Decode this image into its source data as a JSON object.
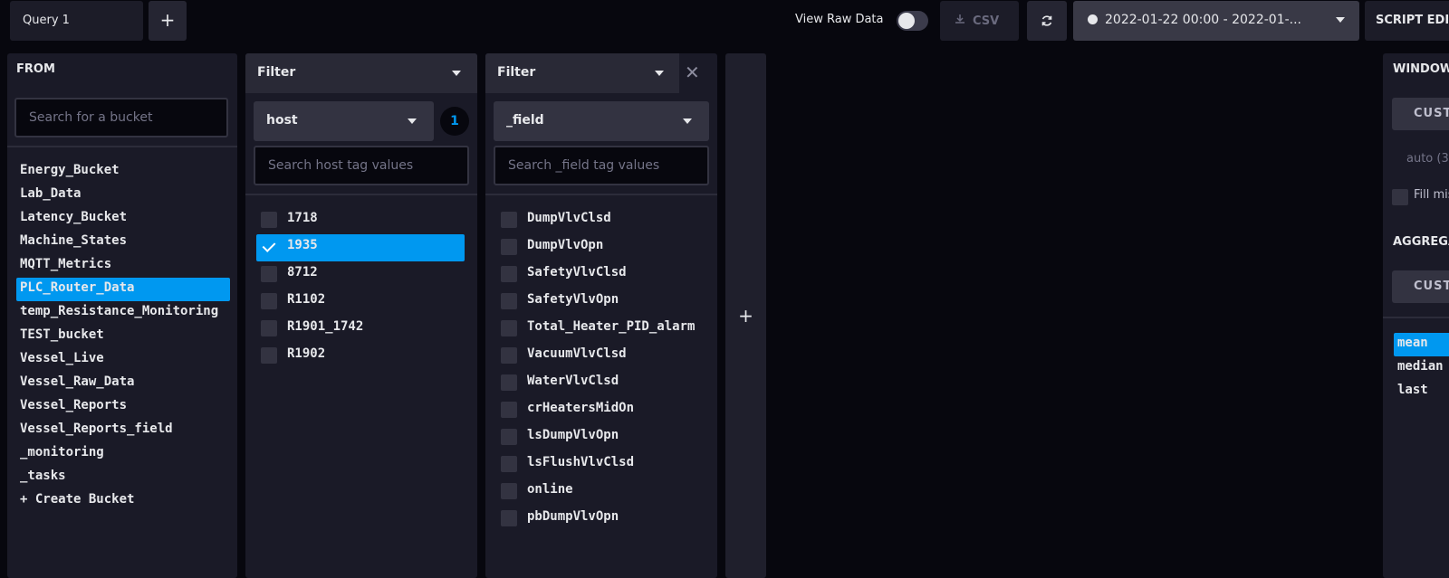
{
  "topbar": {
    "query_tab": "Query 1",
    "add_query": "+",
    "view_raw_label": "View Raw Data",
    "csv_label": "CSV",
    "time_range": "2022-01-22 00:00 - 2022-01-...",
    "script_editor": "SCRIPT EDITOR"
  },
  "from": {
    "title": "FROM",
    "search_placeholder": "Search for a bucket",
    "buckets": [
      "Energy_Bucket",
      "Lab_Data",
      "Latency_Bucket",
      "Machine_States",
      "MQTT_Metrics",
      "PLC_Router_Data",
      "temp_Resistance_Monitoring",
      "TEST_bucket",
      "Vessel_Live",
      "Vessel_Raw_Data",
      "Vessel_Reports",
      "Vessel_Reports_field",
      "_monitoring",
      "_tasks",
      "+ Create Bucket"
    ],
    "selected": "PLC_Router_Data"
  },
  "filter1": {
    "title": "Filter",
    "key": "host",
    "count": "1",
    "search_placeholder": "Search host tag values",
    "values": [
      "1718",
      "1935",
      "8712",
      "R1102",
      "R1901_1742",
      "R1902"
    ],
    "selected": "1935"
  },
  "filter2": {
    "title": "Filter",
    "key": "_field",
    "search_placeholder": "Search _field tag values",
    "values": [
      "DumpVlvClsd",
      "DumpVlvOpn",
      "SafetyVlvClsd",
      "SafetyVlvOpn",
      "Total_Heater_PID_alarm",
      "VacuumVlvClsd",
      "WaterVlvClsd",
      "crHeatersMidOn",
      "lsDumpVlvOpn",
      "lsFlushVlvClsd",
      "online",
      "pbDumpVlvOpn"
    ]
  },
  "add_column": "+",
  "aggregate": {
    "window_label": "WINDOW PERIOD",
    "custom_label": "CUSTOM",
    "auto_label": "auto (3",
    "fill_label": "Fill missing values",
    "aggregate_label": "AGGREGATE FUNCTION",
    "custom2_label": "CUSTOM",
    "functions": [
      "mean",
      "median",
      "last"
    ],
    "selected": "mean"
  }
}
